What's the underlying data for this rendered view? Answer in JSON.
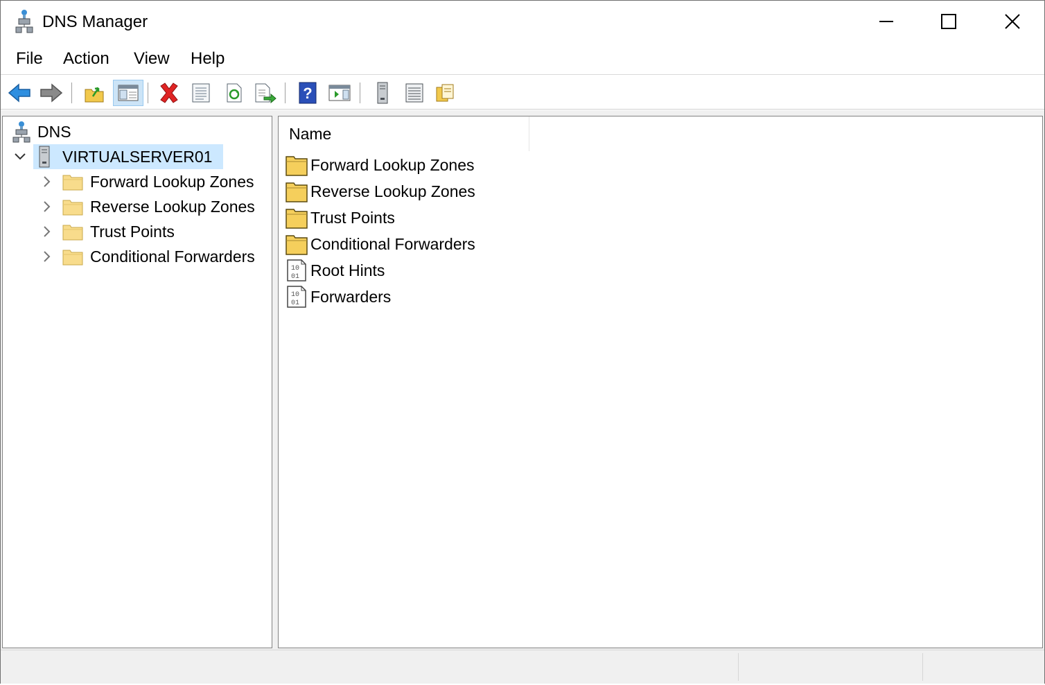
{
  "window": {
    "title": "DNS Manager",
    "app_icon": "dns-manager-icon",
    "controls": [
      "minimize-icon",
      "maximize-icon",
      "close-icon"
    ]
  },
  "menu": {
    "file": "File",
    "action": "Action",
    "view": "View",
    "help": "Help"
  },
  "toolbar": {
    "buttons": [
      "back-arrow-icon",
      "forward-arrow-icon",
      "up-folder-icon",
      "show-hide-console-tree-icon",
      "delete-icon",
      "properties-icon",
      "refresh-icon",
      "export-list-icon",
      "help-icon",
      "show-action-pane-icon",
      "server-icon",
      "record-list-icon",
      "copy-icon"
    ],
    "pressed": "show-hide-console-tree-icon"
  },
  "tree": {
    "root": {
      "label": "DNS",
      "icon": "dns-icon"
    },
    "server": {
      "label": "VIRTUALSERVER01",
      "icon": "server-icon",
      "expanded": true,
      "selected": true
    },
    "children": [
      {
        "label": "Forward Lookup Zones",
        "icon": "folder-icon"
      },
      {
        "label": "Reverse Lookup Zones",
        "icon": "folder-icon"
      },
      {
        "label": "Trust Points",
        "icon": "folder-icon"
      },
      {
        "label": "Conditional Forwarders",
        "icon": "folder-icon"
      }
    ]
  },
  "list": {
    "column_header": "Name",
    "items": [
      {
        "label": "Forward Lookup Zones",
        "icon": "folder-icon"
      },
      {
        "label": "Reverse Lookup Zones",
        "icon": "folder-icon"
      },
      {
        "label": "Trust Points",
        "icon": "folder-icon"
      },
      {
        "label": "Conditional Forwarders",
        "icon": "folder-icon"
      },
      {
        "label": "Root Hints",
        "icon": "binary-file-icon"
      },
      {
        "label": "Forwarders",
        "icon": "binary-file-icon"
      }
    ]
  },
  "colors": {
    "selection": "#cce8ff",
    "pressed_button": "#cce4f7",
    "folder": "#f5d57a",
    "background": "#f0f0f0"
  }
}
